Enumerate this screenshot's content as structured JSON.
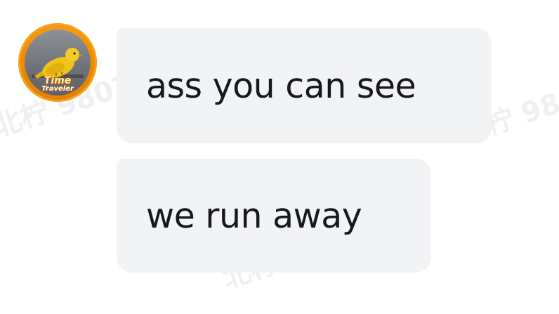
{
  "avatar": {
    "badge_line1": "Time",
    "badge_line2": "Traveler"
  },
  "messages": [
    {
      "text": "ass you can see"
    },
    {
      "text": "we run away"
    }
  ],
  "watermark": {
    "text": "北柠 9807"
  },
  "colors": {
    "bubble_bg": "#f2f3f5",
    "message_text": "#17181c",
    "avatar_ring": "#f08c00",
    "bird": "#f2c21a"
  },
  "icons": {
    "avatar_image": "yellow-bird-icon"
  }
}
